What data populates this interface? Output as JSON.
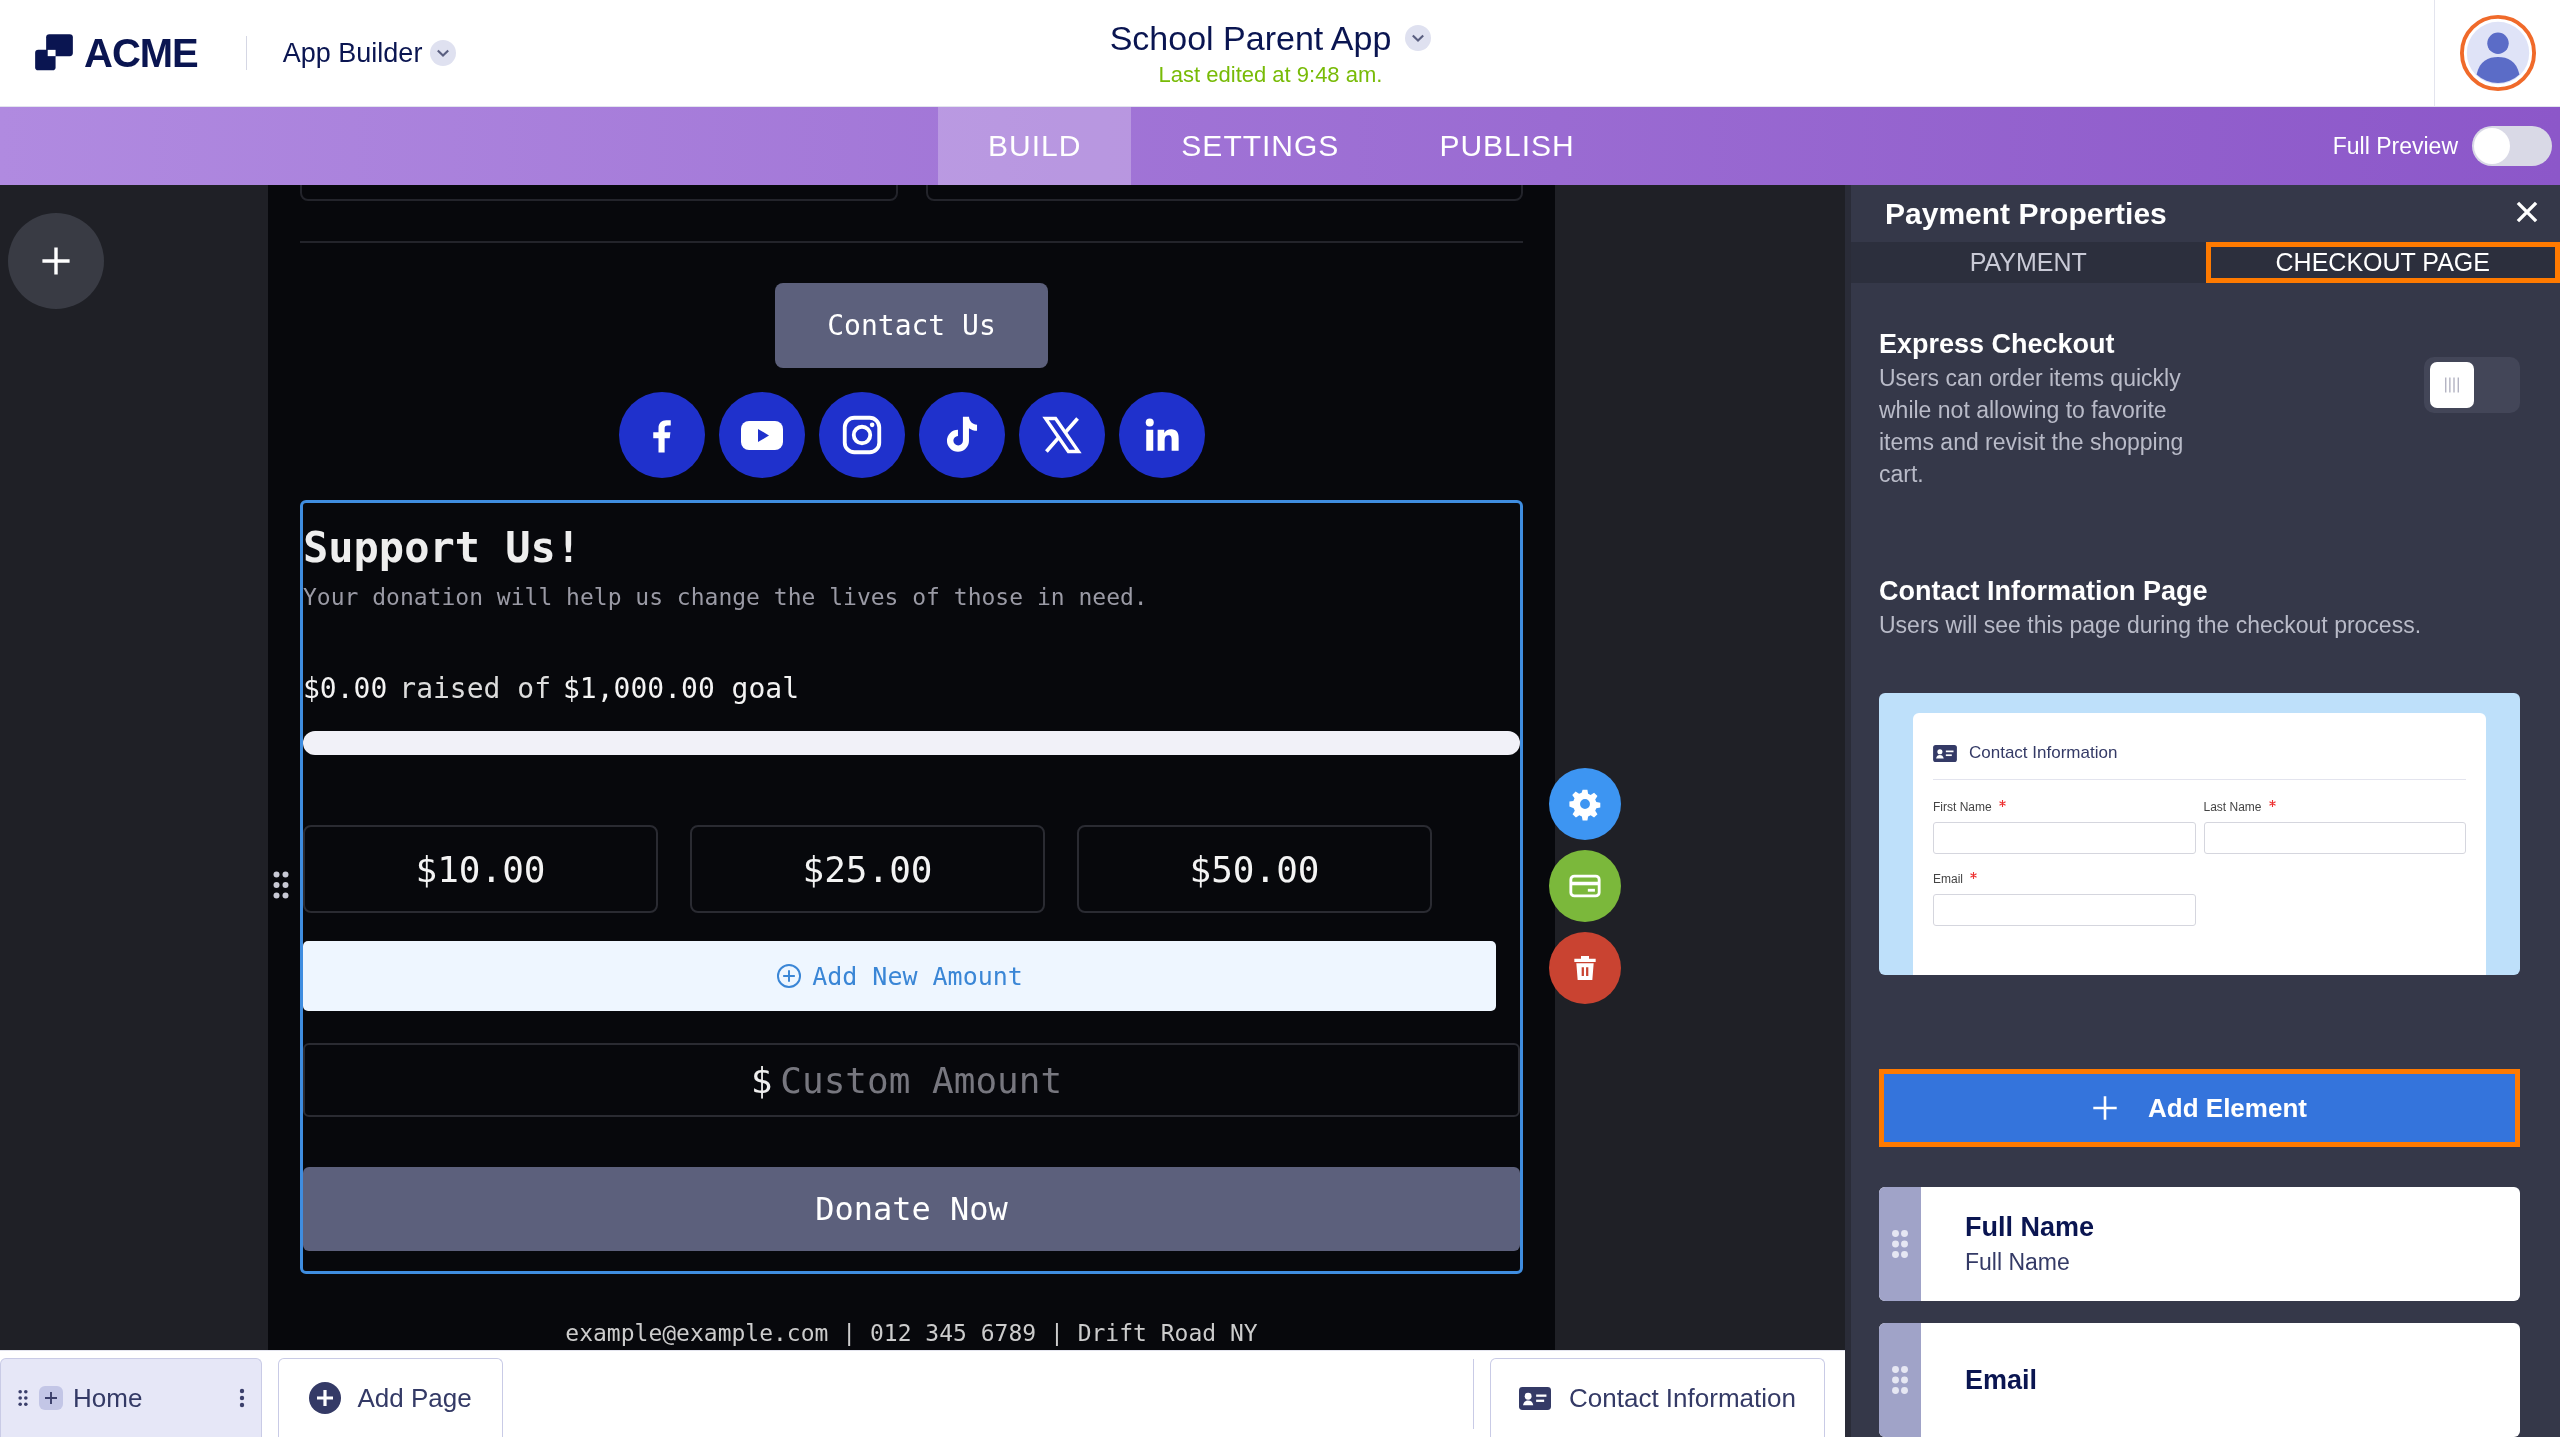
{
  "header": {
    "logo": "ACME",
    "app_switcher": "App Builder",
    "title": "School Parent App",
    "last_edited": "Last edited at 9:48 am."
  },
  "nav": {
    "tabs": [
      {
        "label": "BUILD",
        "selected": true
      },
      {
        "label": "SETTINGS",
        "selected": false
      },
      {
        "label": "PUBLISH",
        "selected": false
      }
    ],
    "full_preview": {
      "label": "Full Preview",
      "on": false
    }
  },
  "canvas": {
    "contact_button": "Contact Us",
    "social": [
      {
        "kind": "facebook"
      },
      {
        "kind": "youtube"
      },
      {
        "kind": "instagram"
      },
      {
        "kind": "tiktok"
      },
      {
        "kind": "x"
      },
      {
        "kind": "linkedin"
      }
    ],
    "donation": {
      "title": "Support Us!",
      "description": "Your donation will help us change the lives of those in need.",
      "raised": "$0.00",
      "raised_text": "raised of",
      "goal": "$1,000.00 goal",
      "level": 0,
      "amounts": [
        "$10.00",
        "$25.00",
        "$50.00"
      ],
      "add_amount": "Add New Amount",
      "currency": "$",
      "custom_placeholder": "Custom Amount",
      "donate_button": "Donate Now"
    },
    "footer": "example@example.com | 012 345 6789 | Drift Road NY"
  },
  "panel": {
    "title": "Payment Properties",
    "tabs": [
      {
        "label": "PAYMENT",
        "selected": false
      },
      {
        "label": "CHECKOUT PAGE",
        "selected": true
      }
    ],
    "express_checkout": {
      "title": "Express Checkout",
      "description": "Users can order items quickly while not allowing to favorite items and revisit the shopping cart.",
      "on": false
    },
    "contact_page": {
      "title": "Contact Information Page",
      "description": "Users will see this page during the checkout process.",
      "preview": {
        "heading": "Contact Information",
        "fields": [
          {
            "label": "First Name",
            "required": true
          },
          {
            "label": "Last Name",
            "required": true
          },
          {
            "label": "Email",
            "required": true
          }
        ]
      }
    },
    "add_element": "Add Element",
    "elements": [
      {
        "title": "Full Name",
        "subtitle": "Full Name"
      },
      {
        "title": "Email"
      }
    ]
  },
  "bottom_bar": {
    "pages": [
      {
        "label": "Home",
        "selected": true
      }
    ],
    "add_page": "Add Page",
    "current_page": "Contact Information"
  }
}
